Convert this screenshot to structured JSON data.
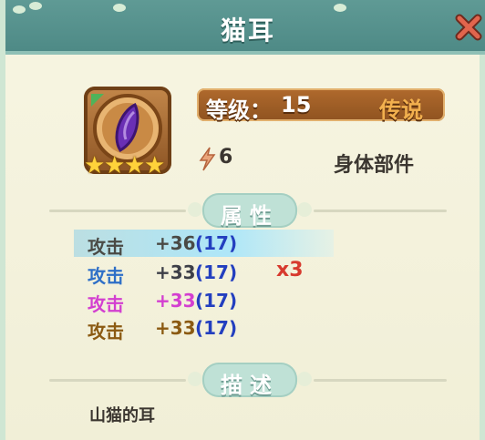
{
  "header": {
    "title": "猫耳"
  },
  "item": {
    "star_count": 4,
    "level_label": "等级：",
    "level_value": "15",
    "rarity": "传说",
    "power_value": "6",
    "type": "身体部件"
  },
  "sections": {
    "attributes_title": "属性",
    "description_title": "描述"
  },
  "stats": [
    {
      "name": "攻击",
      "bonus": "+36",
      "level": "(17)",
      "color": "#4a4a45",
      "bonus_color": "#4a4a45"
    },
    {
      "name": "攻击",
      "bonus": "+33",
      "level": "(17)",
      "color": "#2e6fc7",
      "bonus_color": "#3d3f48"
    },
    {
      "name": "攻击",
      "bonus": "+33",
      "level": "(17)",
      "color": "#d33fd0",
      "bonus_color": "#d33fd0"
    },
    {
      "name": "攻击",
      "bonus": "+33",
      "level": "(17)",
      "color": "#8b5a12",
      "bonus_color": "#8b5a12"
    }
  ],
  "multiplier": "x3",
  "description": "山猫的耳",
  "colors": {
    "header": "#5f9a95",
    "level_bar": "#b06a2d",
    "rarity_text": "#f2b04e",
    "multiplier": "#d73a2e"
  }
}
